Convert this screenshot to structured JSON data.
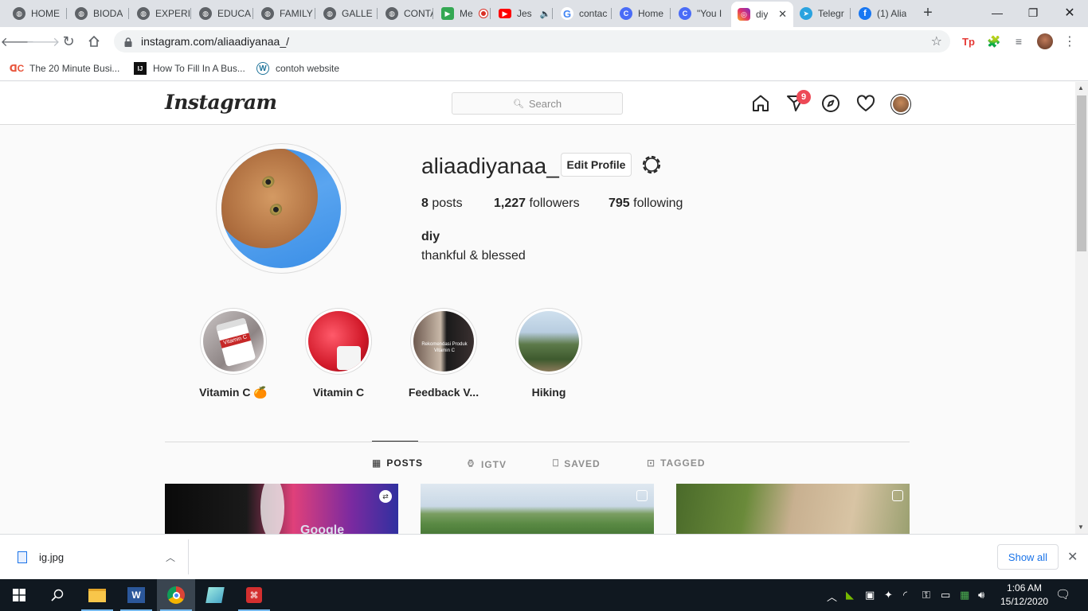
{
  "browser": {
    "tabs": [
      {
        "label": "HOME",
        "icon": "globe-icon"
      },
      {
        "label": "BIODA",
        "icon": "globe-icon"
      },
      {
        "label": "EXPERI",
        "icon": "globe-icon"
      },
      {
        "label": "EDUCA",
        "icon": "globe-icon"
      },
      {
        "label": "FAMILY",
        "icon": "globe-icon"
      },
      {
        "label": "GALLE",
        "icon": "globe-icon"
      },
      {
        "label": "CONTA",
        "icon": "globe-icon"
      },
      {
        "label": "Me",
        "icon": "meet-icon"
      },
      {
        "label": "Jes",
        "icon": "youtube-icon"
      },
      {
        "label": "contac",
        "icon": "google-icon"
      },
      {
        "label": "Home",
        "icon": "canva-icon"
      },
      {
        "label": "\"You I",
        "icon": "canva-icon"
      },
      {
        "label": "diy",
        "icon": "instagram-icon",
        "active": true
      },
      {
        "label": "Telegr",
        "icon": "telegram-icon"
      },
      {
        "label": "(1) Alia",
        "icon": "facebook-icon"
      }
    ],
    "url": "instagram.com/aliaadiyanaa_/",
    "bookmarks": [
      {
        "label": "The 20 Minute Busi...",
        "icon": "cx-icon"
      },
      {
        "label": "How To Fill In A Bus...",
        "icon": "ij-icon"
      },
      {
        "label": "contoh website",
        "icon": "wordpress-icon"
      }
    ]
  },
  "instagram": {
    "logo": "Instagram",
    "search_placeholder": "Search",
    "notification_count": "9",
    "profile": {
      "username": "aliaadiyanaa_",
      "edit_label": "Edit Profile",
      "posts_count": "8",
      "posts_label": "posts",
      "followers_count": "1,227",
      "followers_label": "followers",
      "following_count": "795",
      "following_label": "following",
      "full_name": "diy",
      "bio": "thankful & blessed"
    },
    "highlights": [
      {
        "label": "Vitamin C 🍊",
        "thumb_text": "Vitamin C"
      },
      {
        "label": "Vitamin C"
      },
      {
        "label": "Feedback V...",
        "thumb_text": "Rekomendasi Produk Vitamin C"
      },
      {
        "label": "Hiking"
      }
    ],
    "tabs": [
      {
        "label": "POSTS",
        "active": true
      },
      {
        "label": "IGTV"
      },
      {
        "label": "SAVED"
      },
      {
        "label": "TAGGED"
      }
    ],
    "post_texts": [
      "Google"
    ]
  },
  "downloads": {
    "file": "ig.jpg",
    "show_all": "Show all"
  },
  "taskbar": {
    "time": "1:06 AM",
    "date": "15/12/2020"
  }
}
